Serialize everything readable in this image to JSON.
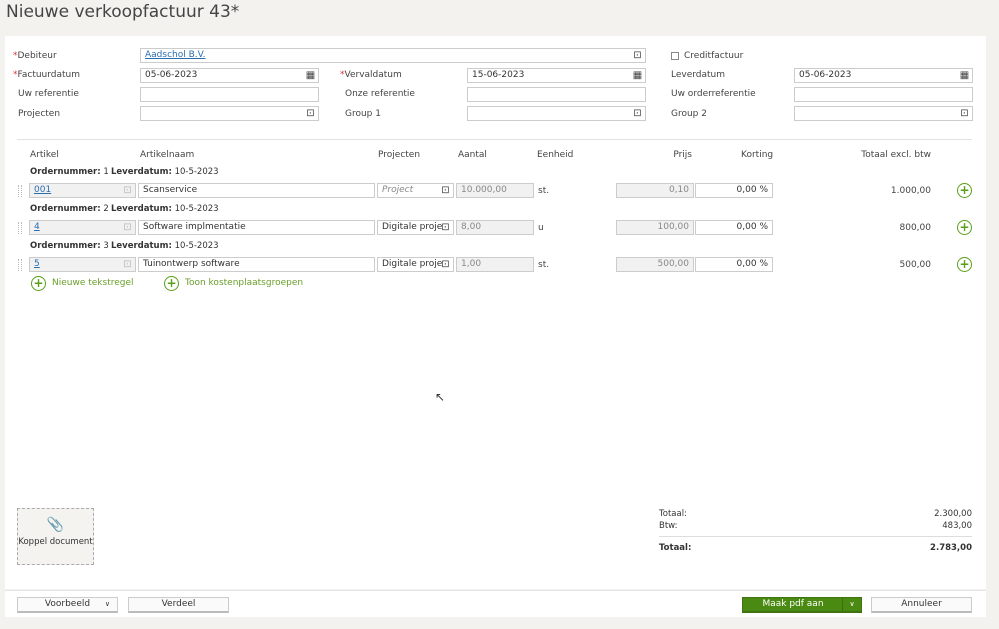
{
  "title": "Nieuwe verkoopfactuur 43*",
  "header": {
    "debiteur_label": "Debiteur",
    "debiteur_value": "Aadschol B.V.",
    "creditfactuur_label": "Creditfactuur",
    "factuurdatum_label": "Factuurdatum",
    "factuurdatum_value": "05-06-2023",
    "vervaldatum_label": "Vervaldatum",
    "vervaldatum_value": "15-06-2023",
    "leverdatum_label": "Leverdatum",
    "leverdatum_value": "05-06-2023",
    "uw_referentie_label": "Uw referentie",
    "onze_referentie_label": "Onze referentie",
    "uw_orderreferentie_label": "Uw orderreferentie",
    "projecten_label": "Projecten",
    "group1_label": "Group 1",
    "group2_label": "Group 2"
  },
  "columns": {
    "artikel": "Artikel",
    "artikelnaam": "Artikelnaam",
    "projecten": "Projecten",
    "aantal": "Aantal",
    "eenheid": "Eenheid",
    "prijs": "Prijs",
    "korting": "Korting",
    "totaal": "Totaal excl. btw"
  },
  "order_label": "Ordernummer:",
  "leverdatum_row_label": "Leverdatum:",
  "lines": [
    {
      "order": "1",
      "leverdatum": "10-5-2023",
      "artikel": "001",
      "naam": "Scanservice",
      "project": "",
      "project_placeholder": "Project",
      "aantal": "10.000,00",
      "eenheid": "st.",
      "prijs": "0,10",
      "korting": "0,00 %",
      "totaal": "1.000,00"
    },
    {
      "order": "2",
      "leverdatum": "10-5-2023",
      "artikel": "4",
      "naam": "Software implmentatie",
      "project": "Digitale proje",
      "project_placeholder": "",
      "aantal": "8,00",
      "eenheid": "u",
      "prijs": "100,00",
      "korting": "0,00 %",
      "totaal": "800,00"
    },
    {
      "order": "3",
      "leverdatum": "10-5-2023",
      "artikel": "5",
      "naam": "Tuinontwerp software",
      "project": "Digitale proje",
      "project_placeholder": "",
      "aantal": "1,00",
      "eenheid": "st.",
      "prijs": "500,00",
      "korting": "0,00 %",
      "totaal": "500,00"
    }
  ],
  "actions": {
    "new_text_line": "Nieuwe tekstregel",
    "show_cost_groups": "Toon kostenplaatsgroepen"
  },
  "attach": {
    "label": "Koppel document"
  },
  "totals": {
    "subtotal_label": "Totaal:",
    "subtotal": "2.300,00",
    "btw_label": "Btw:",
    "btw": "483,00",
    "total_label": "Totaal:",
    "total": "2.783,00"
  },
  "footer": {
    "preview": "Voorbeeld",
    "share": "Verdeel",
    "make_pdf": "Maak pdf aan",
    "cancel": "Annuleer"
  },
  "colors": {
    "accent": "#5a9e1a",
    "primary_button": "#4a8a12",
    "link": "#2a6fb0"
  }
}
